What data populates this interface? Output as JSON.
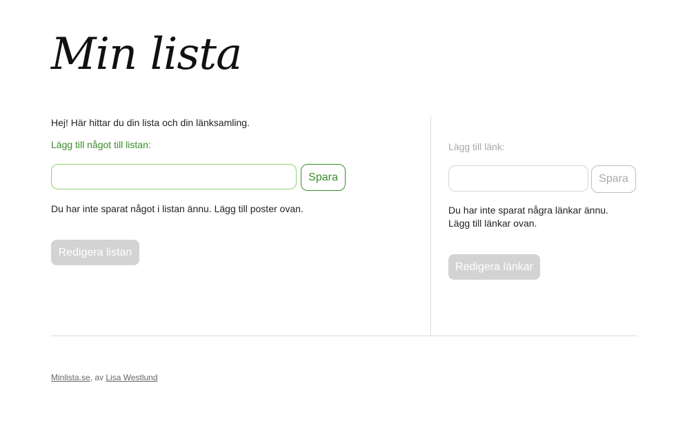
{
  "header": {
    "title": "Min lista"
  },
  "list_section": {
    "intro": "Hej! Här hittar du din lista och din länksamling.",
    "add_label": "Lägg till något till listan:",
    "input_value": "",
    "save_label": "Spara",
    "empty_message": "Du har inte sparat något i listan ännu. Lägg till poster ovan.",
    "edit_label": "Redigera listan"
  },
  "links_section": {
    "add_label": "Lägg till länk:",
    "input_value": "",
    "save_label": "Spara",
    "empty_message_line1": "Du har inte sparat några länkar ännu.",
    "empty_message_line2": "Lägg till länkar ovan.",
    "edit_label": "Redigera länkar"
  },
  "footer": {
    "site_link": "Minlista.se",
    "separator": ", av ",
    "author_link": "Lisa Westlund"
  },
  "colors": {
    "accent_green": "#3a8a2a",
    "input_border_green": "#8fd16a",
    "disabled_gray": "#d3d3d3",
    "divider": "#dcdcdc"
  }
}
